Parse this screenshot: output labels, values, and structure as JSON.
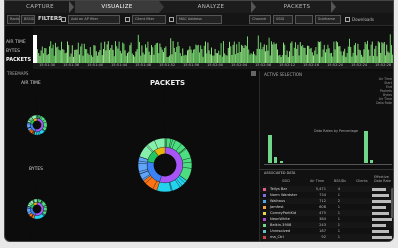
{
  "nav": {
    "tabs": [
      {
        "label": "CAPTURE"
      },
      {
        "label": "VISUALIZE"
      },
      {
        "label": "ANALYZE"
      },
      {
        "label": "PACKETS"
      }
    ]
  },
  "filters": {
    "mode_label": "Radio",
    "mode_value": "BSSID",
    "title": "FILTERS",
    "fields": [
      "Add an AP filter",
      "Client filter",
      "MAC Address",
      "Channel",
      "SSID",
      "Subframe"
    ],
    "download_label": "Downloads",
    "colors": {
      "accent": "#8ee07f"
    }
  },
  "timeline": {
    "labels": [
      "AIR TIME",
      "BYTES",
      "PACKETS"
    ],
    "ticks": [
      "15:51:30",
      "15:51:36",
      "15:51:40",
      "15:51:44",
      "15:51:48",
      "15:51:52",
      "15:51:56",
      "15:52:00",
      "15:52:04",
      "15:52:08",
      "15:52:12",
      "15:52:16",
      "15:52:20",
      "15:52:24",
      "15:52:28"
    ]
  },
  "treemap": {
    "header": "TREEMAPS",
    "small_charts": [
      {
        "label": "AIR TIME"
      },
      {
        "label": "BYTES"
      }
    ],
    "big_title": "PACKETS"
  },
  "selection": {
    "header": "ACTIVE SELECTION",
    "stats": [
      "Air Time",
      "Start",
      "End",
      "Packets",
      "Bytes",
      "Air Time",
      "Data Rate"
    ],
    "footer": "Data Rates by Percentage"
  },
  "associated": {
    "header": "ASSOCIATED DATA",
    "columns": [
      "SSID",
      "Air Time",
      "BSSIDs",
      "Clients",
      "Effective Data Rate"
    ],
    "rows": [
      {
        "name": "Tellys Bar",
        "air": "5,471",
        "bssids": "4",
        "clients": "",
        "color": "#e65b8a"
      },
      {
        "name": "Norm Wardster",
        "air": "734",
        "bssids": "1",
        "clients": "",
        "color": "#7c6fe0"
      },
      {
        "name": "Walhaus",
        "air": "712",
        "bssids": "2",
        "clients": "",
        "color": "#56a7e8"
      },
      {
        "name": "Jamfest",
        "air": "608",
        "bssids": "1",
        "clients": "",
        "color": "#f0a046"
      },
      {
        "name": "CorneyParkKid",
        "air": "475",
        "bssids": "1",
        "clients": "",
        "color": "#e8d94f"
      },
      {
        "name": "NeonWhite",
        "air": "384",
        "bssids": "1",
        "clients": "",
        "color": "#a64fd1"
      },
      {
        "name": "Belkin.3908",
        "air": "243",
        "bssids": "1",
        "clients": "",
        "color": "#6fd68a"
      },
      {
        "name": "Unresolved",
        "air": "187",
        "bssids": "1",
        "clients": "",
        "color": "#5fc3c7"
      },
      {
        "name": "ma_Ctrl",
        "air": "92",
        "bssids": "1",
        "clients": "",
        "color": "#c44"
      }
    ]
  }
}
